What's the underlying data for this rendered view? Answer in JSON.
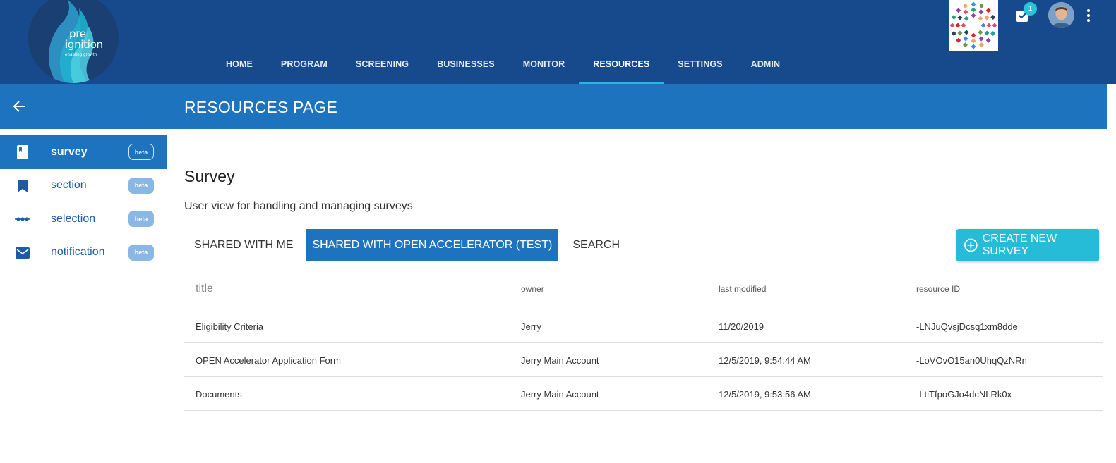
{
  "logo": {
    "line1": "pre",
    "line2": "ignition",
    "tagline": "enabling   growth"
  },
  "nav": {
    "items": [
      {
        "label": "HOME"
      },
      {
        "label": "PROGRAM"
      },
      {
        "label": "SCREENING"
      },
      {
        "label": "BUSINESSES"
      },
      {
        "label": "MONITOR"
      },
      {
        "label": "RESOURCES",
        "active": true
      },
      {
        "label": "SETTINGS"
      },
      {
        "label": "ADMIN"
      }
    ]
  },
  "header": {
    "tasks_count": "1",
    "icons": {
      "tasks": "check-box-icon",
      "menu": "more-vert-icon"
    }
  },
  "page": {
    "title": "RESOURCES PAGE",
    "back_icon": "arrow-back-icon"
  },
  "sidebar": {
    "items": [
      {
        "label": "survey",
        "badge": "beta",
        "icon": "book-icon",
        "active": true
      },
      {
        "label": "section",
        "badge": "beta",
        "icon": "bookmark-icon"
      },
      {
        "label": "selection",
        "badge": "beta",
        "icon": "dots-line-icon"
      },
      {
        "label": "notification",
        "badge": "beta",
        "icon": "mail-icon"
      }
    ]
  },
  "main": {
    "title": "Survey",
    "description": "User view for handling and managing surveys",
    "tabs": [
      {
        "label": "SHARED WITH ME"
      },
      {
        "label": "SHARED WITH  OPEN ACCELERATOR (TEST)",
        "active": true
      },
      {
        "label": "SEARCH"
      }
    ],
    "create_button": "CREATE NEW SURVEY"
  },
  "table": {
    "filter_placeholder": "title",
    "columns": [
      "owner",
      "last modified",
      "resource ID"
    ],
    "rows": [
      [
        "Eligibility Criteria",
        "Jerry",
        "11/20/2019",
        "-LNJuQvsjDcsq1xm8dde"
      ],
      [
        "OPEN Accelerator Application Form",
        "Jerry Main Account",
        "12/5/2019, 9:54:44 AM",
        "-LoVOvO15an0UhqQzNRn"
      ],
      [
        "Documents",
        "Jerry Main Account",
        "12/5/2019, 9:53:56 AM",
        "-LtiTfpoGJo4dcNLRk0x"
      ]
    ]
  },
  "colors": {
    "topbar": "#174a8c",
    "pagebar": "#1e73bf",
    "accent": "#26bcd8",
    "nav_indicator": "#29b6e6"
  }
}
